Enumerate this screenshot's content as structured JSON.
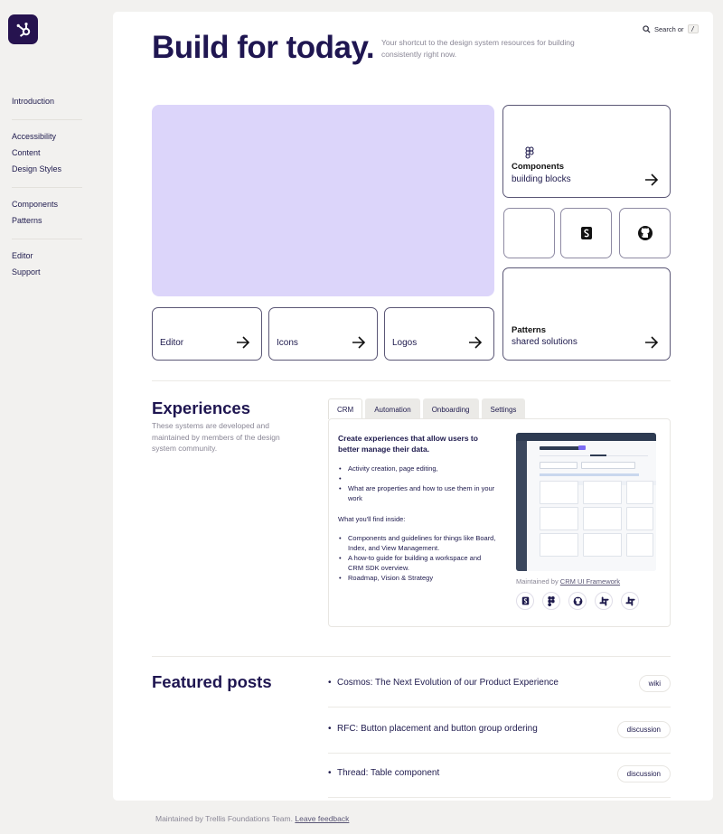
{
  "sidebar": {
    "groups": [
      [
        "Introduction"
      ],
      [
        "Accessibility",
        "Content",
        "Design Styles"
      ],
      [
        "Components",
        "Patterns"
      ],
      [
        "Editor",
        "Support"
      ]
    ]
  },
  "header": {
    "title": "Build for today.",
    "subtitle": "Your shortcut to the design system resources for building consistently right now.",
    "search_label": "Search or",
    "search_key": "/"
  },
  "quick_links": {
    "editor": "Editor",
    "icons": "Icons",
    "logos": "Logos",
    "components_title": "Components",
    "components_sub": "building blocks",
    "patterns_title": "Patterns",
    "patterns_sub": "shared solutions"
  },
  "experiences": {
    "title": "Experiences",
    "description": "These systems are developed and maintained by members of the design system community.",
    "tabs": [
      "CRM",
      "Automation",
      "Onboarding",
      "Settings"
    ],
    "active_tab": "CRM",
    "panel": {
      "heading": "Create experiences that allow users to better manage their data.",
      "bullets_top": [
        "Activity creation, page editing,",
        "",
        "What are properties and how to use them in your work"
      ],
      "find_label": "What you'll find inside:",
      "bullets_bottom": [
        "Components and guidelines for things like Board, Index, and View Management.",
        "A how-to guide for building a workspace and CRM SDK overview.",
        "Roadmap, Vision & Strategy"
      ],
      "maintained_prefix": "Maintained by",
      "maintained_link": "CRM UI Framework"
    }
  },
  "featured": {
    "title": "Featured posts",
    "posts": [
      {
        "title": "Cosmos: The Next Evolution of our Product Experience",
        "tag": "wiki"
      },
      {
        "title": "RFC: Button placement and button group ordering",
        "tag": "discussion"
      },
      {
        "title": "Thread: Table component",
        "tag": "discussion"
      }
    ]
  },
  "footer": {
    "text": "Maintained by Trellis Foundations Team.",
    "link": "Leave feedback"
  },
  "colors": {
    "brand": "#26134f",
    "feature_bg": "#dcd5fa",
    "text": "#1e1a4d",
    "muted": "#8a8796"
  }
}
